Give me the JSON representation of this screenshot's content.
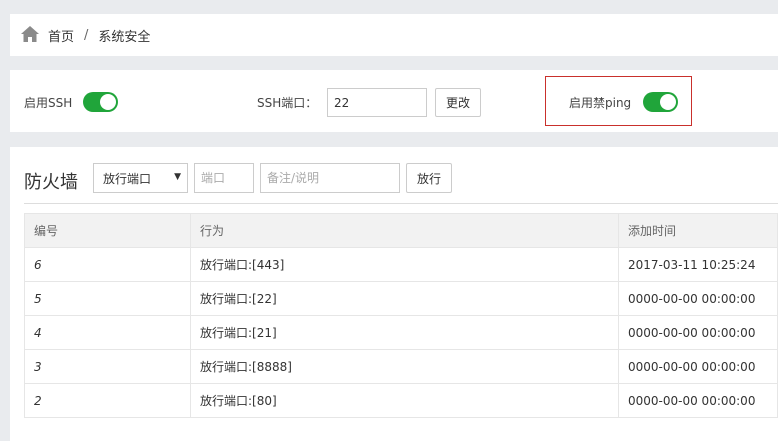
{
  "breadcrumb": {
    "home": "首页",
    "separator": "/",
    "current": "系统安全"
  },
  "settings": {
    "ssh_label": "启用SSH",
    "ssh_port_label": "SSH端口：",
    "ssh_port_value": "22",
    "change_button": "更改",
    "ping_label": "启用禁ping"
  },
  "firewall": {
    "title": "防火墙",
    "select_value": "放行端口",
    "port_placeholder": "端口",
    "note_placeholder": "备注/说明",
    "allow_button": "放行",
    "columns": [
      "编号",
      "行为",
      "添加时间"
    ],
    "rows": [
      {
        "id": "6",
        "action": "放行端口:[443]",
        "time": "2017-03-11 10:25:24"
      },
      {
        "id": "5",
        "action": "放行端口:[22]",
        "time": "0000-00-00 00:00:00"
      },
      {
        "id": "4",
        "action": "放行端口:[21]",
        "time": "0000-00-00 00:00:00"
      },
      {
        "id": "3",
        "action": "放行端口:[8888]",
        "time": "0000-00-00 00:00:00"
      },
      {
        "id": "2",
        "action": "放行端口:[80]",
        "time": "0000-00-00 00:00:00"
      }
    ]
  },
  "colors": {
    "toggle_on": "#20a53a",
    "highlight_border": "#c9302c"
  },
  "icons": {
    "home": "home-icon",
    "caret": "caret-down-icon"
  }
}
